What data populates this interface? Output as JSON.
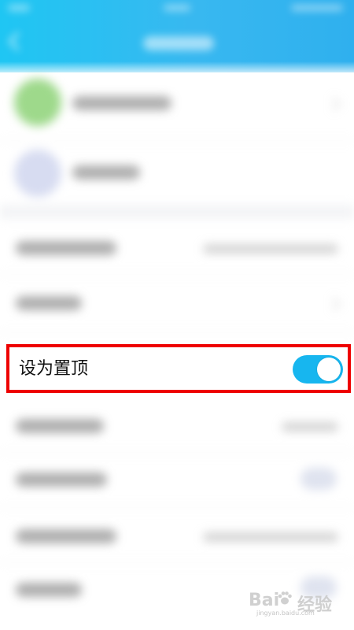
{
  "highlighted_row": {
    "label": "设为置顶",
    "toggle_on": true
  },
  "colors": {
    "header_start": "#1fc6f3",
    "header_end": "#2fb0ee",
    "toggle_on": "#17b6ef",
    "highlight_border": "#ee0000"
  },
  "watermark": {
    "brand": "Bai",
    "brand_cn": "经验",
    "url": "jingyan.baidu.com"
  }
}
